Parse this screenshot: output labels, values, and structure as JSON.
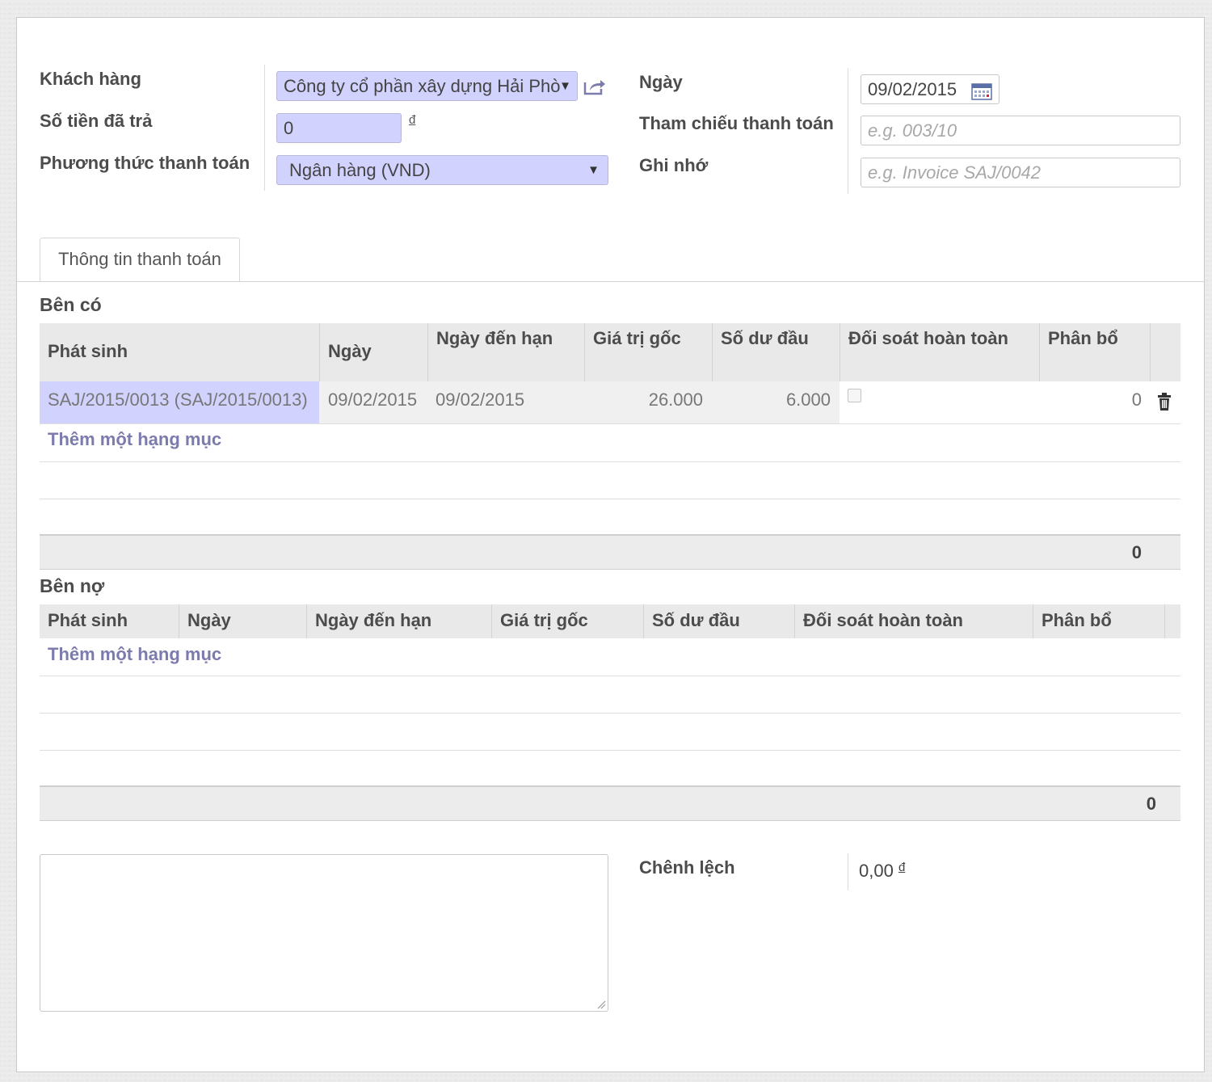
{
  "form": {
    "customer_label": "Khách hàng",
    "customer_value": "Công ty cổ phần xây dựng Hải Phò",
    "amount_label": "Số tiền đã trả",
    "amount_value": "0",
    "currency_symbol": "đ",
    "method_label": "Phương thức thanh toán",
    "method_value": "Ngân hàng (VND)",
    "date_label": "Ngày",
    "date_value": "09/02/2015",
    "reference_label": "Tham chiếu thanh toán",
    "reference_placeholder": "e.g. 003/10",
    "memo_label": "Ghi nhớ",
    "memo_placeholder": "e.g. Invoice SAJ/0042"
  },
  "tabs": [
    {
      "label": "Thông tin thanh toán",
      "active": true
    }
  ],
  "credits": {
    "title": "Bên có",
    "columns": [
      "Phát sinh",
      "Ngày",
      "Ngày đến hạn",
      "Giá trị gốc",
      "Số dư đầu",
      "Đối soát hoàn toàn",
      "Phân bổ"
    ],
    "rows": [
      {
        "move": "SAJ/2015/0013 (SAJ/2015/0013)",
        "date": "09/02/2015",
        "due_date": "09/02/2015",
        "original": "26.000",
        "open_balance": "6.000",
        "full_reconcile": false,
        "allocation": "0"
      }
    ],
    "add_item": "Thêm một hạng mục",
    "total": "0"
  },
  "debits": {
    "title": "Bên nợ",
    "columns": [
      "Phát sinh",
      "Ngày",
      "Ngày đến hạn",
      "Giá trị gốc",
      "Số dư đầu",
      "Đối soát hoàn toàn",
      "Phân bổ"
    ],
    "rows": [],
    "add_item": "Thêm một hạng mục",
    "total": "0"
  },
  "difference": {
    "label": "Chênh lệch",
    "value": "0,00",
    "currency": "đ"
  },
  "colors": {
    "required_field": "#d2d2ff",
    "link": "#7c7bad",
    "header_bg": "#e9e9e9"
  },
  "icons": {
    "external_link": "external-link-icon",
    "calendar": "calendar-icon",
    "delete": "trash-icon",
    "dropdown": "caret-down-icon"
  }
}
